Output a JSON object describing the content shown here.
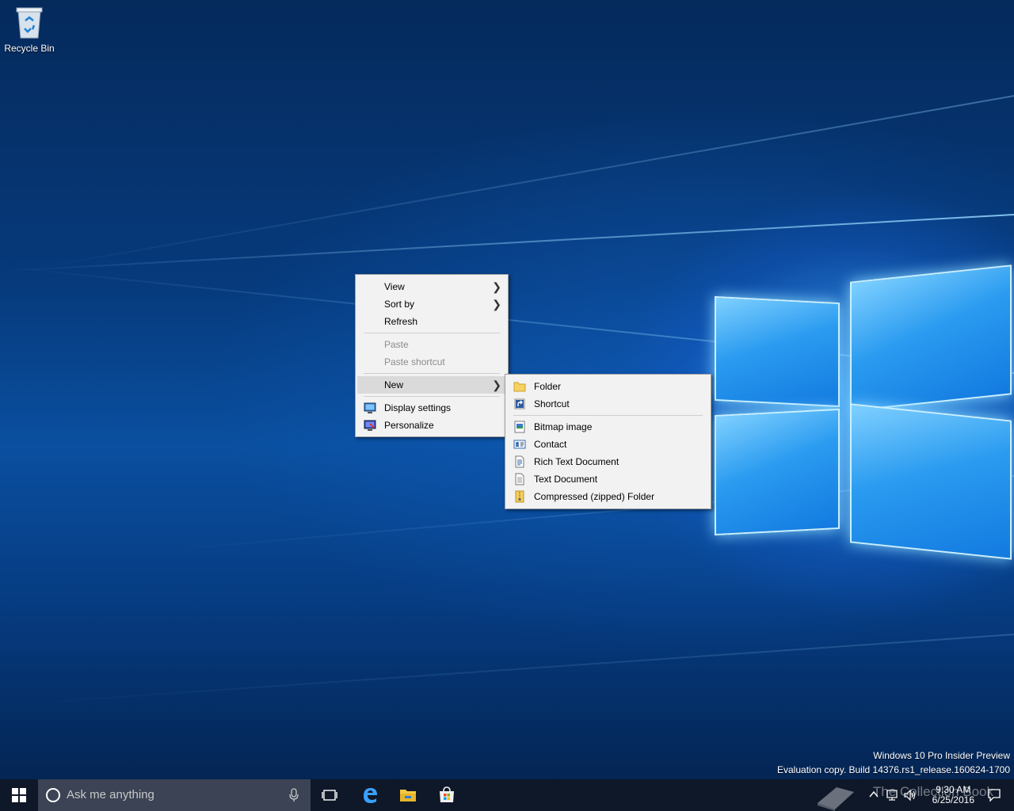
{
  "desktop": {
    "icons": [
      {
        "label": "Recycle Bin",
        "icon": "recycle-bin-icon"
      }
    ]
  },
  "context_menu": {
    "items": [
      {
        "label": "View",
        "has_submenu": true
      },
      {
        "label": "Sort by",
        "has_submenu": true
      },
      {
        "label": "Refresh"
      },
      {
        "label": "Paste",
        "disabled": true
      },
      {
        "label": "Paste shortcut",
        "disabled": true
      },
      {
        "label": "New",
        "has_submenu": true,
        "highlighted": true
      },
      {
        "label": "Display settings",
        "icon": "display-settings-icon"
      },
      {
        "label": "Personalize",
        "icon": "personalize-icon"
      }
    ]
  },
  "new_submenu": {
    "items": [
      {
        "label": "Folder",
        "icon": "folder-icon"
      },
      {
        "label": "Shortcut",
        "icon": "shortcut-icon"
      },
      {
        "label": "Bitmap image",
        "icon": "bitmap-icon"
      },
      {
        "label": "Contact",
        "icon": "contact-icon"
      },
      {
        "label": "Rich Text Document",
        "icon": "rich-text-icon"
      },
      {
        "label": "Text Document",
        "icon": "text-document-icon"
      },
      {
        "label": "Compressed (zipped) Folder",
        "icon": "zip-folder-icon"
      }
    ]
  },
  "watermark": {
    "line1": "Windows 10 Pro Insider Preview",
    "line2": "Evaluation copy. Build 14376.rs1_release.160624-1700"
  },
  "taskbar": {
    "search_placeholder": "Ask me anything",
    "pinned": [
      "task-view-icon",
      "edge-icon",
      "file-explorer-icon",
      "store-icon"
    ],
    "tray_overlay_text": "The Collection Book",
    "clock": {
      "time": "9:30 AM",
      "date": "6/25/2016"
    }
  },
  "colors": {
    "menu_bg": "#f2f2f2",
    "menu_highlight": "#dadada",
    "taskbar_bg": "#101826",
    "search_bg": "#3b4354",
    "accent": "#0078d7"
  }
}
